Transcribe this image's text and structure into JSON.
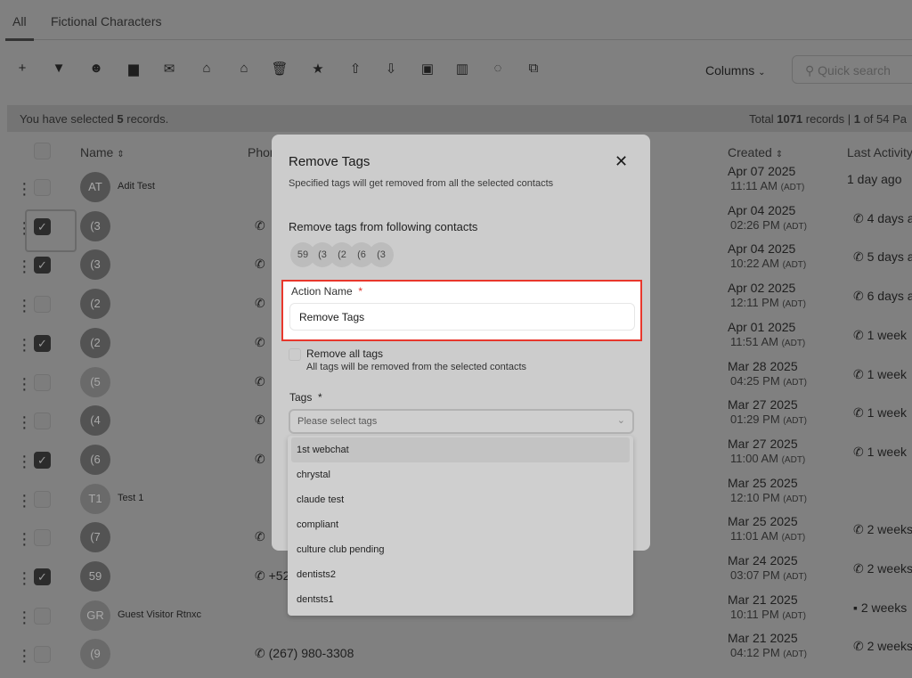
{
  "tabs": [
    {
      "label": "All",
      "active": true
    },
    {
      "label": "Fictional Characters"
    }
  ],
  "toolbar": {
    "icons": [
      "plus-icon",
      "filter-icon",
      "robot-icon",
      "message-icon",
      "mail-icon",
      "tag-add-icon",
      "tag-remove-icon",
      "trash-icon",
      "star-icon",
      "upload-icon",
      "download-icon",
      "lock-icon",
      "building-icon",
      "whatsapp-icon",
      "copy-icon"
    ],
    "columns_label": "Columns",
    "search_placeholder": "Quick search"
  },
  "selection": {
    "prefix": "You have selected ",
    "count": "5",
    "suffix": " records.",
    "total_prefix": "Total ",
    "total": "1071",
    "total_mid": " records | ",
    "page": "1",
    "page_suffix": " of 54 Pa"
  },
  "headers": {
    "name": "Name",
    "phone": "Phor",
    "created": "Created",
    "last_activity": "Last Activity"
  },
  "rows": [
    {
      "avatar": "AT",
      "name": "Adit Test",
      "checked": false,
      "phone": "",
      "date": "Apr 07 2025",
      "time": "11:11 AM",
      "tz": "(ADT)",
      "activity": "1 day ago",
      "activity_icon": ""
    },
    {
      "avatar": "(3",
      "name": "",
      "checked": true,
      "focused": true,
      "phone": "",
      "phone_icon": true,
      "date": "Apr 04 2025",
      "time": "02:26 PM",
      "tz": "(ADT)",
      "activity": "4 days a",
      "activity_icon": "phone"
    },
    {
      "avatar": "(3",
      "name": "",
      "checked": true,
      "phone": "",
      "phone_icon": true,
      "date": "Apr 04 2025",
      "time": "10:22 AM",
      "tz": "(ADT)",
      "activity": "5 days a",
      "activity_icon": "phone"
    },
    {
      "avatar": "(2",
      "name": "",
      "checked": false,
      "phone": "",
      "phone_icon": true,
      "date": "Apr 02 2025",
      "time": "12:11 PM",
      "tz": "(ADT)",
      "activity": "6 days a",
      "activity_icon": "phone"
    },
    {
      "avatar": "(2",
      "name": "",
      "checked": true,
      "phone": "",
      "phone_icon": true,
      "date": "Apr 01 2025",
      "time": "11:51 AM",
      "tz": "(ADT)",
      "activity": "1 week",
      "activity_icon": "phone"
    },
    {
      "avatar": "(5",
      "name": "",
      "checked": false,
      "light": true,
      "phone": "",
      "phone_icon": true,
      "date": "Mar 28 2025",
      "time": "04:25 PM",
      "tz": "(ADT)",
      "activity": "1 week",
      "activity_icon": "phone"
    },
    {
      "avatar": "(4",
      "name": "",
      "checked": false,
      "phone": "",
      "phone_icon": true,
      "date": "Mar 27 2025",
      "time": "01:29 PM",
      "tz": "(ADT)",
      "activity": "1 week",
      "activity_icon": "phone"
    },
    {
      "avatar": "(6",
      "name": "",
      "checked": true,
      "phone": "",
      "phone_icon": true,
      "date": "Mar 27 2025",
      "time": "11:00 AM",
      "tz": "(ADT)",
      "activity": "1 week",
      "activity_icon": "phone"
    },
    {
      "avatar": "T1",
      "name": "Test 1",
      "checked": false,
      "light": true,
      "phone": "",
      "date": "Mar 25 2025",
      "time": "12:10 PM",
      "tz": "(ADT)",
      "activity": "",
      "activity_icon": ""
    },
    {
      "avatar": "(7",
      "name": "",
      "checked": false,
      "phone": "",
      "phone_icon": true,
      "date": "Mar 25 2025",
      "time": "11:01 AM",
      "tz": "(ADT)",
      "activity": "2 weeks",
      "activity_icon": "phone"
    },
    {
      "avatar": "59",
      "name": "",
      "checked": true,
      "phone": "+52",
      "phone_icon": true,
      "date": "Mar 24 2025",
      "time": "03:07 PM",
      "tz": "(ADT)",
      "activity": "2 weeks",
      "activity_icon": "phone"
    },
    {
      "avatar": "GR",
      "name": "Guest Visitor Rtnxc",
      "checked": false,
      "light": true,
      "phone": "",
      "date": "Mar 21 2025",
      "time": "10:11 PM",
      "tz": "(ADT)",
      "activity": "2 weeks",
      "activity_icon": "chat"
    },
    {
      "avatar": "(9",
      "name": "",
      "checked": false,
      "light": true,
      "phone": "(267) 980-3308",
      "phone_icon": true,
      "date": "Mar 21 2025",
      "time": "04:12 PM",
      "tz": "(ADT)",
      "activity": "2 weeks",
      "activity_icon": "phone"
    }
  ],
  "modal": {
    "title": "Remove Tags",
    "subtitle": "Specified tags will get removed from all the selected contacts",
    "contacts_heading": "Remove tags from following contacts",
    "contacts": [
      "59",
      "(3",
      "(2",
      "(6",
      "(3"
    ],
    "action_label": "Action Name",
    "required_mark": "*",
    "action_value": "Remove Tags",
    "remove_all_label": "Remove all tags",
    "remove_all_desc": "All tags will be removed from the selected contacts",
    "tags_label": "Tags",
    "tags_placeholder": "Please select tags"
  },
  "dropdown": {
    "options": [
      "1st webchat",
      "chrystal",
      "claude test",
      "compliant",
      "culture club pending",
      "dentists2",
      "dentsts1"
    ]
  },
  "colors": {
    "highlight_border": "#e8372c",
    "overlay": "#808080"
  }
}
